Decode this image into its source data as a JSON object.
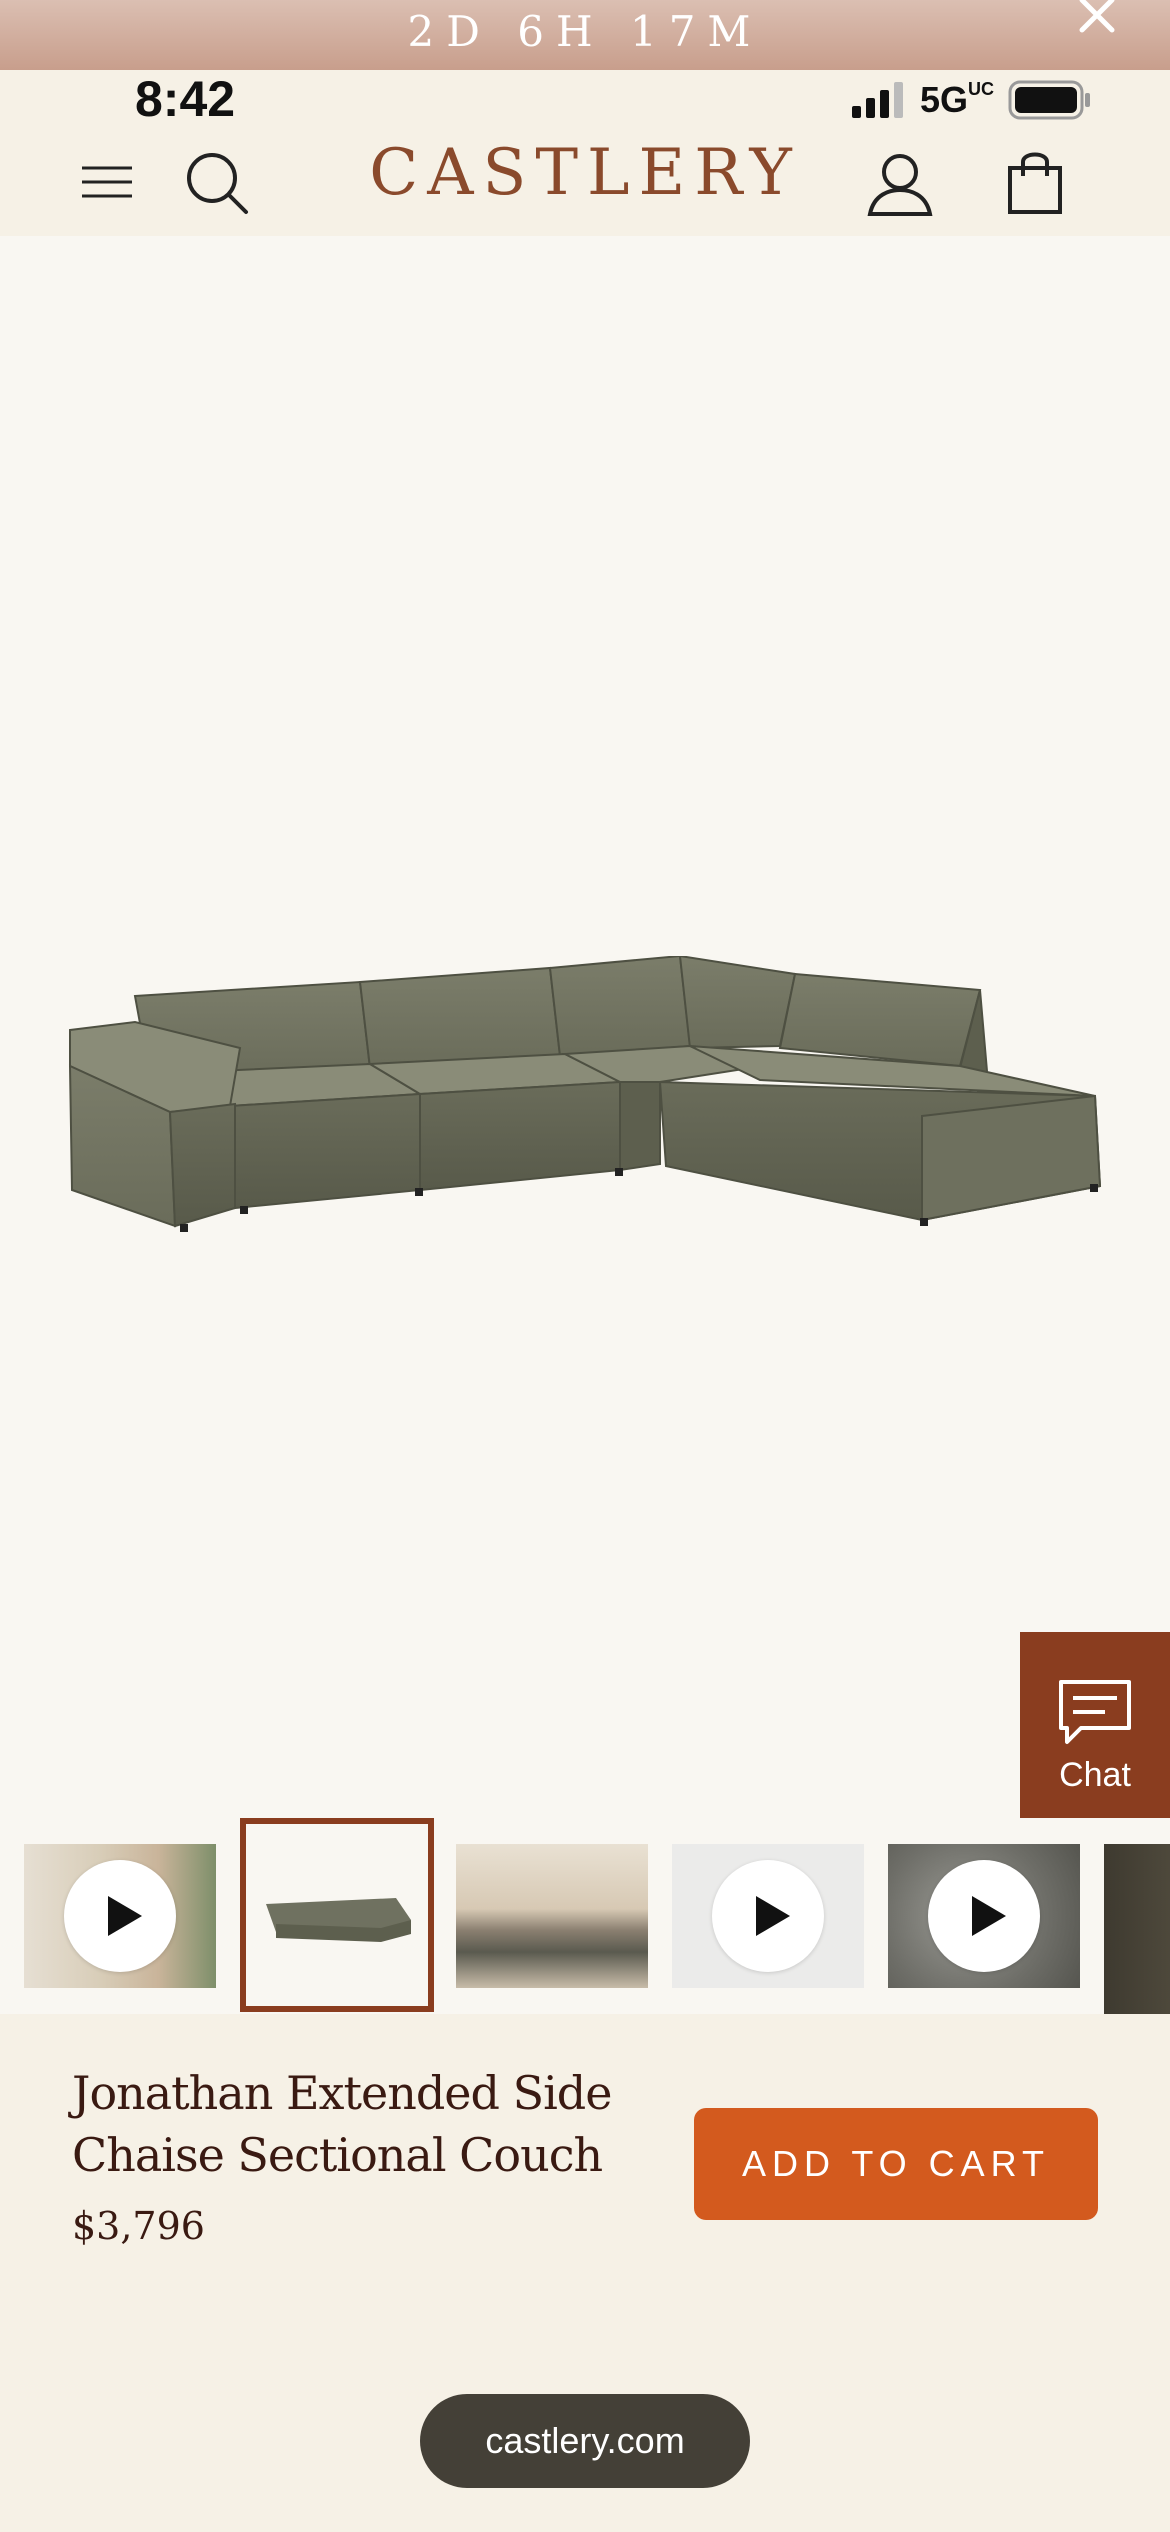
{
  "promo": {
    "countdown": "2D 6H 17M"
  },
  "status_bar": {
    "time": "8:42",
    "network": "5G",
    "network_suffix": "UC"
  },
  "header": {
    "logo": "CASTLERY"
  },
  "chat": {
    "label": "Chat"
  },
  "gallery": {
    "thumbnails": [
      {
        "kind": "video"
      },
      {
        "kind": "image",
        "selected": true
      },
      {
        "kind": "image"
      },
      {
        "kind": "video"
      },
      {
        "kind": "video"
      },
      {
        "kind": "image"
      }
    ]
  },
  "product": {
    "title": "Jonathan Extended Side Chaise Sectional Couch",
    "price": "$3,796",
    "add_to_cart": "ADD TO CART"
  },
  "browser": {
    "url": "castlery.com"
  },
  "colors": {
    "brand": "#8a4a2c",
    "cta": "#d35a1e",
    "chat_bg": "#8a3d1f",
    "header_bg": "#f6f1e6"
  }
}
